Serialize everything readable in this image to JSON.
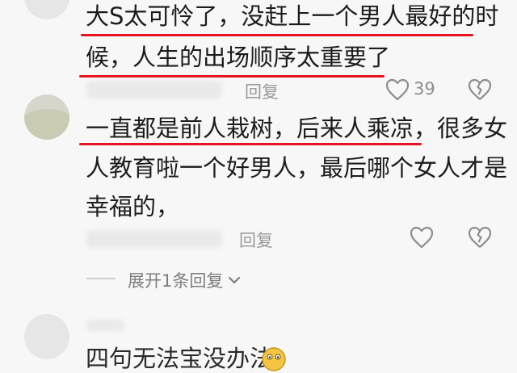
{
  "comments": [
    {
      "lines": [
        "大S太可怜了，没赶上一个男人最好的时",
        "候，人生的出场顺序太重要了"
      ],
      "reply_label": "回复",
      "like_count": "39",
      "like_icon": "heart-outline-icon",
      "dislike_icon": "broken-heart-icon"
    },
    {
      "lines": [
        "一直都是前人栽树，后来人乘凉，很多女",
        "人教育啦一个好男人，最后哪个女人才是",
        "幸福的，"
      ],
      "reply_label": "回复",
      "like_icon": "heart-outline-icon",
      "dislike_icon": "broken-heart-icon",
      "expand_label": "展开1条回复"
    },
    {
      "lines": [
        "四句无法宝没办法"
      ]
    }
  ],
  "colors": {
    "underline": "#e8121e",
    "meta": "#9a9a9a",
    "background": "#f7f7f7"
  }
}
